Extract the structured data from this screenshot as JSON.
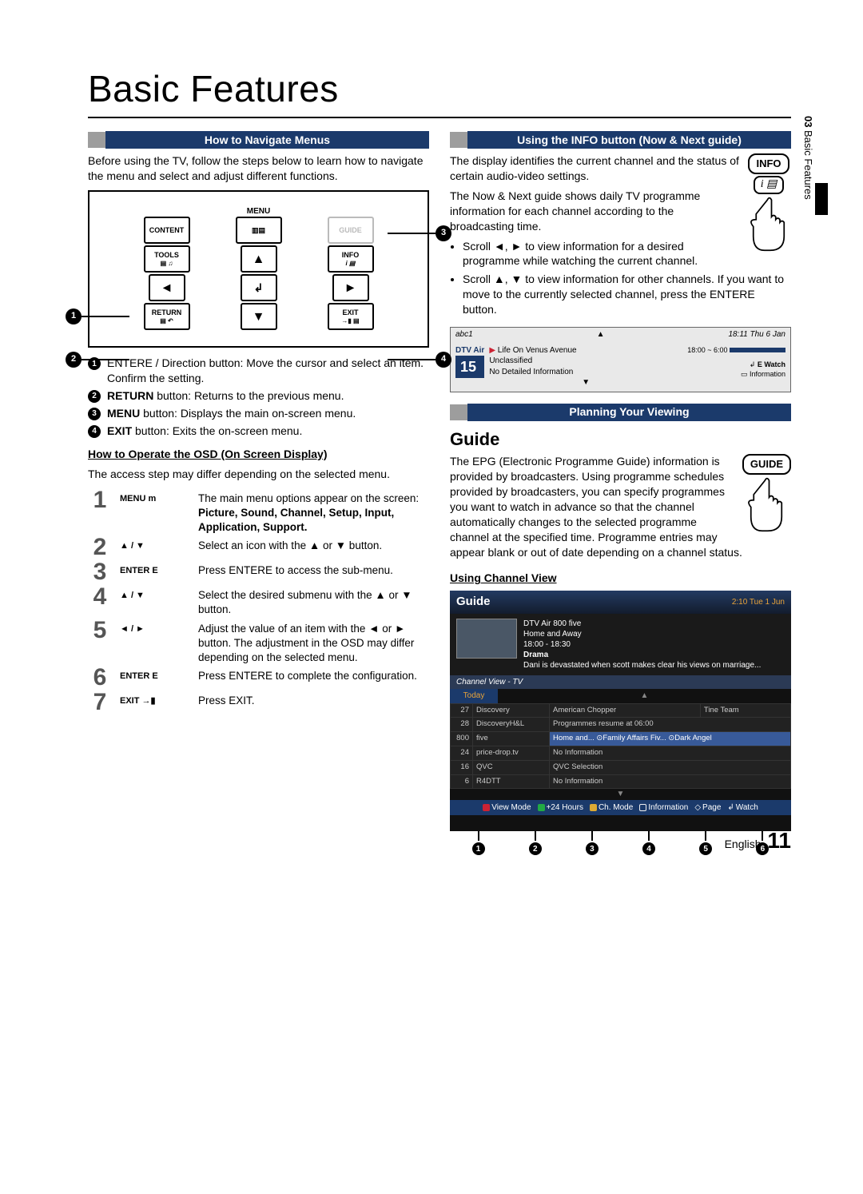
{
  "page": {
    "title": "Basic Features",
    "section_tab_number": "03",
    "section_tab_label": "Basic Features",
    "footer_lang": "English",
    "footer_page": "11"
  },
  "left": {
    "heading": "How to Navigate Menus",
    "intro": "Before using the TV, follow the steps below to learn how to navigate the menu and select and adjust different functions.",
    "remote": {
      "menu_label": "MENU",
      "content": "CONTENT",
      "tools": "TOOLS",
      "info": "INFO",
      "return": "RETURN",
      "exit": "EXIT"
    },
    "legend": [
      {
        "n": "1",
        "text": "ENTERE / Direction button: Move the cursor and select an item. Confirm the setting."
      },
      {
        "n": "2",
        "text": "RETURN button: Returns to the previous menu."
      },
      {
        "n": "3",
        "text": "MENU button: Displays the main on-screen menu."
      },
      {
        "n": "4",
        "text": "EXIT button: Exits the on-screen menu."
      }
    ],
    "osd_title": "How to Operate the OSD (On Screen Display)",
    "osd_note": "The access step may differ depending on the selected menu.",
    "steps": [
      {
        "n": "1",
        "key": "MENU m",
        "desc": "The main menu options appear on the screen:",
        "desc2": "Picture, Sound, Channel, Setup, Input, Application, Support."
      },
      {
        "n": "2",
        "key": "▲ / ▼",
        "desc": "Select an icon with the ▲ or ▼ button."
      },
      {
        "n": "3",
        "key": "ENTER E",
        "desc": "Press ENTERE to access the sub-menu."
      },
      {
        "n": "4",
        "key": "▲ / ▼",
        "desc": "Select the desired submenu with the ▲ or ▼ button."
      },
      {
        "n": "5",
        "key": "◄ / ►",
        "desc": "Adjust the value of an item with the ◄ or ► button. The adjustment in the OSD may differ depending on the selected menu."
      },
      {
        "n": "6",
        "key": "ENTER E",
        "desc": "Press ENTERE to complete the configuration."
      },
      {
        "n": "7",
        "key": "EXIT →▮",
        "desc": "Press EXIT."
      }
    ]
  },
  "right": {
    "info_heading": "Using the INFO button (Now & Next guide)",
    "info_btn_label": "INFO",
    "info_p1": "The display identifies the current channel and the status of certain audio-video settings.",
    "info_p2": "The Now & Next guide shows daily TV programme information for each channel according to the broadcasting time.",
    "info_b1": "Scroll ◄, ► to view information for a desired programme while watching the current channel.",
    "info_b2": "Scroll ▲, ▼ to view information for other channels. If you want to move to the currently selected channel, press the ENTERE button.",
    "nownext": {
      "channel_name": "abc1",
      "clock": "18:11 Thu 6 Jan",
      "service": "DTV Air",
      "number": "15",
      "title": "Life On Venus Avenue",
      "rating": "Unclassified",
      "detail": "No Detailed Information",
      "timeslot": "18:00 ~ 6:00",
      "hint1": "E Watch",
      "hint2": "Information"
    },
    "plan_heading": "Planning Your Viewing",
    "guide_title": "Guide",
    "guide_btn_label": "GUIDE",
    "guide_text": "The EPG (Electronic Programme Guide) information is provided by broadcasters. Using programme schedules provided by broadcasters, you can specify programmes you want to watch in advance so that the channel automatically changes to the selected programme channel at the specified time. Programme entries may appear blank or out of date depending on a channel status.",
    "using_cv": "Using  Channel View",
    "guide_panel": {
      "title": "Guide",
      "clock": "2:10 Tue 1 Jun",
      "prog_line1": "DTV Air 800 five",
      "prog_line2": "Home and Away",
      "prog_line3": "18:00 - 18:30",
      "prog_line4": "Drama",
      "prog_line5": "Dani is devastated when scott makes clear his views on marriage...",
      "section": "Channel View - TV",
      "today": "Today",
      "rows": [
        {
          "num": "27",
          "ch": "Discovery",
          "a": "American Chopper",
          "b": "Tine Team"
        },
        {
          "num": "28",
          "ch": "DiscoveryH&L",
          "a": "Programmes resume at 06:00",
          "b": ""
        },
        {
          "num": "800",
          "ch": "five",
          "a": "Home and...   ⊙Family Affairs   Fiv...   ⊙Dark Angel",
          "b": ""
        },
        {
          "num": "24",
          "ch": "price-drop.tv",
          "a": "No Information",
          "b": ""
        },
        {
          "num": "16",
          "ch": "QVC",
          "a": "QVC Selection",
          "b": ""
        },
        {
          "num": "6",
          "ch": "R4DTT",
          "a": "No Information",
          "b": ""
        }
      ],
      "footer": {
        "view_mode": "View Mode",
        "hours": "+24 Hours",
        "ch_mode": "Ch. Mode",
        "information": "Information",
        "page": "Page",
        "watch": "Watch"
      },
      "callouts": [
        "1",
        "2",
        "3",
        "4",
        "5",
        "6"
      ]
    }
  }
}
